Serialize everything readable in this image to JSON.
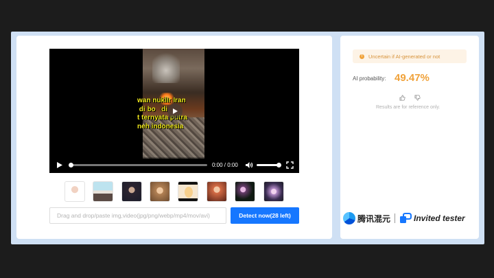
{
  "player": {
    "caption": "wan nuklir Iran\n di bo   di\nt ternyata putra\nneh indonesia",
    "time": "0:00 / 0:00"
  },
  "thumbnails": [
    "sample-1",
    "sample-2",
    "sample-3",
    "sample-4",
    "sample-5",
    "sample-6",
    "sample-7",
    "sample-8"
  ],
  "upload": {
    "placeholder": "Drag and drop/paste img,video(jpg/png/webp/mp4/mov/avi)",
    "button": "Detect now(28 left)"
  },
  "result": {
    "notice": "Uncertain if AI-generated or not",
    "probability_label": "AI probability:",
    "probability_value": "49.47%",
    "note": "Results are for reference only."
  },
  "brand": {
    "name": "腾讯混元",
    "tester": "Invited tester"
  },
  "colors": {
    "accent": "#1677ff",
    "warning": "#f0a23a",
    "frame": "#cfe0f4"
  }
}
